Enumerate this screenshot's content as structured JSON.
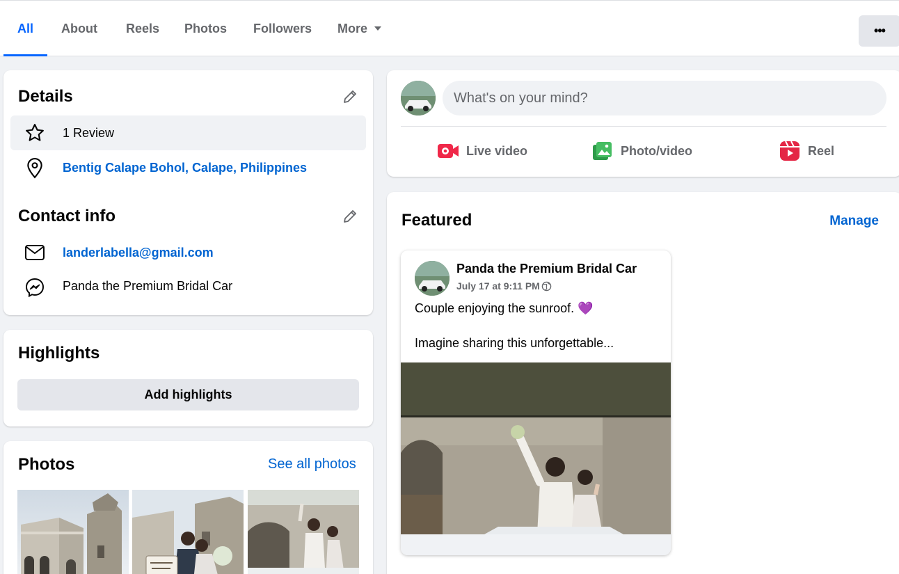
{
  "tabs": {
    "items": [
      "All",
      "About",
      "Reels",
      "Photos",
      "Followers"
    ],
    "more_label": "More",
    "overflow_label": "•••"
  },
  "details": {
    "title": "Details",
    "review": "1 Review",
    "location": "Bentig Calape Bohol, Calape, Philippines"
  },
  "contact": {
    "title": "Contact info",
    "email": "landerlabella@gmail.com",
    "messenger": "Panda the Premium Bridal Car"
  },
  "highlights": {
    "title": "Highlights",
    "add_label": "Add highlights"
  },
  "photos": {
    "title": "Photos",
    "see_all": "See all photos"
  },
  "composer": {
    "placeholder": "What's on your mind?",
    "live": "Live video",
    "photo": "Photo/video",
    "reel": "Reel"
  },
  "featured": {
    "title": "Featured",
    "manage": "Manage",
    "post": {
      "author": "Panda the Premium Bridal Car",
      "date": "July 17 at 9:11 PM",
      "line1": "Couple enjoying the sunroof. 💜",
      "line2": "Imagine sharing this unforgettable..."
    }
  },
  "colors": {
    "accent": "#0866ff",
    "link": "#0064d1",
    "live": "#f02849",
    "photo": "#45bd62",
    "reel": "#e42645"
  }
}
